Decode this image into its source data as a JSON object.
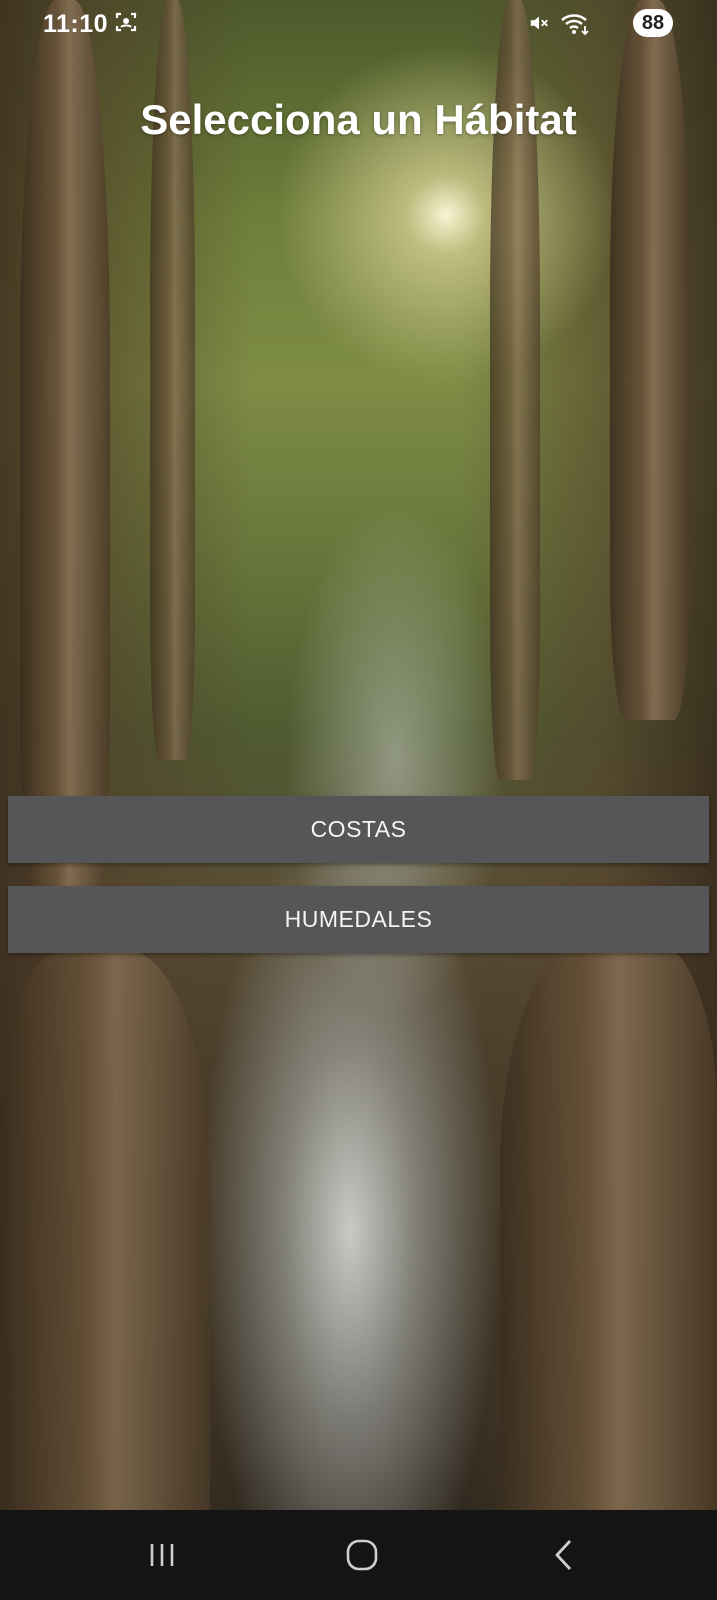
{
  "status_bar": {
    "time": "11:10",
    "battery_level": "88",
    "icons": [
      "face-scan-icon",
      "mute-icon",
      "wifi-icon",
      "battery-icon"
    ]
  },
  "screen": {
    "title": "Selecciona un Hábitat",
    "background": "mangrove-forest-photo"
  },
  "habitats": [
    {
      "label": "COSTAS"
    },
    {
      "label": "HUMEDALES"
    }
  ],
  "navigation_bar": {
    "buttons": [
      "recent-apps-icon",
      "home-icon",
      "back-icon"
    ]
  },
  "colors": {
    "button_background": "#565558",
    "button_text": "#f4f4f4",
    "title_text": "#ffffff",
    "nav_background": "#141414"
  }
}
